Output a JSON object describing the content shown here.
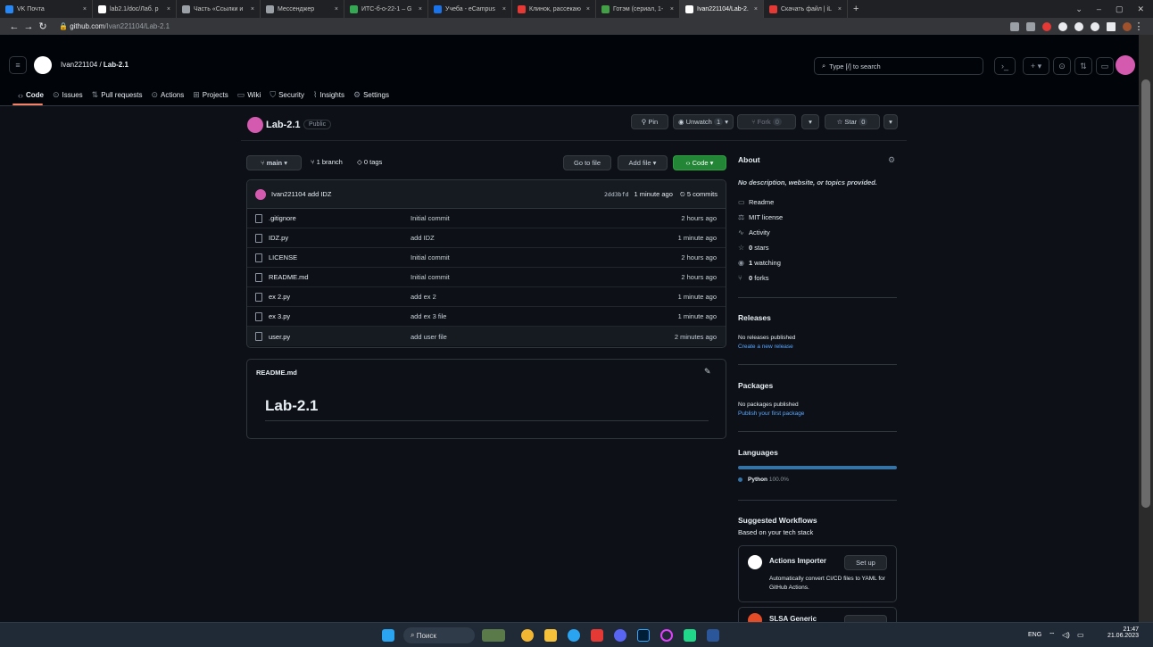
{
  "browser": {
    "tabs": [
      {
        "label": "VK Почта",
        "color": "#2787f5"
      },
      {
        "label": "lab2.1/doc/Лаб. р",
        "color": "#ffffff"
      },
      {
        "label": "Часть «Ссылки и",
        "color": "#9aa0a6"
      },
      {
        "label": "Мессенджер",
        "color": "#9aa0a6"
      },
      {
        "label": "ИТС-б-о-22-1 – G",
        "color": "#34a853"
      },
      {
        "label": "Учеба - eCampus",
        "color": "#1a73e8"
      },
      {
        "label": "Клинок, рассекаю",
        "color": "#e53935"
      },
      {
        "label": "Готэм (сериал, 1-",
        "color": "#43a047"
      },
      {
        "label": "Ivan221104/Lab-2.",
        "color": "#ffffff"
      },
      {
        "label": "Скачать файл | iL",
        "color": "#e53935"
      }
    ],
    "url_host": "github.com",
    "url_path": "/Ivan221104/Lab-2.1"
  },
  "header": {
    "owner": "Ivan221104",
    "repo": "Lab-2.1",
    "search_placeholder": "Type [/] to search",
    "nav": [
      {
        "icon": "‹›",
        "label": "Code"
      },
      {
        "icon": "⊙",
        "label": "Issues"
      },
      {
        "icon": "⇅",
        "label": "Pull requests"
      },
      {
        "icon": "⊙",
        "label": "Actions"
      },
      {
        "icon": "⊞",
        "label": "Projects"
      },
      {
        "icon": "▭",
        "label": "Wiki"
      },
      {
        "icon": "⛉",
        "label": "Security"
      },
      {
        "icon": "⌇",
        "label": "Insights"
      },
      {
        "icon": "⚙",
        "label": "Settings"
      }
    ]
  },
  "repo": {
    "title": "Lab-2.1",
    "visibility": "Public",
    "pin": "Pin",
    "unwatch": "Unwatch",
    "unwatch_count": "1",
    "fork": "Fork",
    "fork_count": "0",
    "star": "Star",
    "star_count": "0",
    "branch": "main",
    "branches": "1 branch",
    "tags": "0 tags",
    "go_to_file": "Go to file",
    "add_file": "Add file",
    "code": "Code"
  },
  "commit": {
    "author": "Ivan221104",
    "message": "add IDZ",
    "hash": "2dd3bfd",
    "time": "1 minute ago",
    "commits": "5 commits"
  },
  "files": [
    {
      "name": ".gitignore",
      "message": "Initial commit",
      "time": "2 hours ago"
    },
    {
      "name": "IDZ.py",
      "message": "add IDZ",
      "time": "1 minute ago"
    },
    {
      "name": "LICENSE",
      "message": "Initial commit",
      "time": "2 hours ago"
    },
    {
      "name": "README.md",
      "message": "Initial commit",
      "time": "2 hours ago"
    },
    {
      "name": "ex 2.py",
      "message": "add ex 2",
      "time": "1 minute ago"
    },
    {
      "name": "ex 3.py",
      "message": "add ex 3 file",
      "time": "1 minute ago"
    },
    {
      "name": "user.py",
      "message": "add user file",
      "time": "2 minutes ago"
    }
  ],
  "readme": {
    "filename": "README.md",
    "heading": "Lab-2.1"
  },
  "about": {
    "title": "About",
    "description": "No description, website, or topics provided.",
    "readme": "Readme",
    "license": "MIT license",
    "activity": "Activity",
    "stars_count": "0",
    "stars_label": "stars",
    "watching_count": "1",
    "watching_label": "watching",
    "forks_count": "0",
    "forks_label": "forks"
  },
  "releases": {
    "title": "Releases",
    "none": "No releases published",
    "create": "Create a new release"
  },
  "packages": {
    "title": "Packages",
    "none": "No packages published",
    "publish": "Publish your first package"
  },
  "languages": {
    "title": "Languages",
    "items": [
      {
        "name": "Python",
        "percent": "100.0%",
        "color": "#3572A5"
      }
    ]
  },
  "workflows": {
    "title": "Suggested Workflows",
    "subtitle": "Based on your tech stack",
    "card1_title": "Actions Importer",
    "card1_button": "Set up",
    "card1_desc": "Automatically convert CI/CD files to YAML for GitHub Actions.",
    "card2_title": "SLSA Generic"
  },
  "taskbar": {
    "search": "Поиск",
    "lang": "ENG",
    "time": "21:47",
    "date": "21.06.2023"
  }
}
